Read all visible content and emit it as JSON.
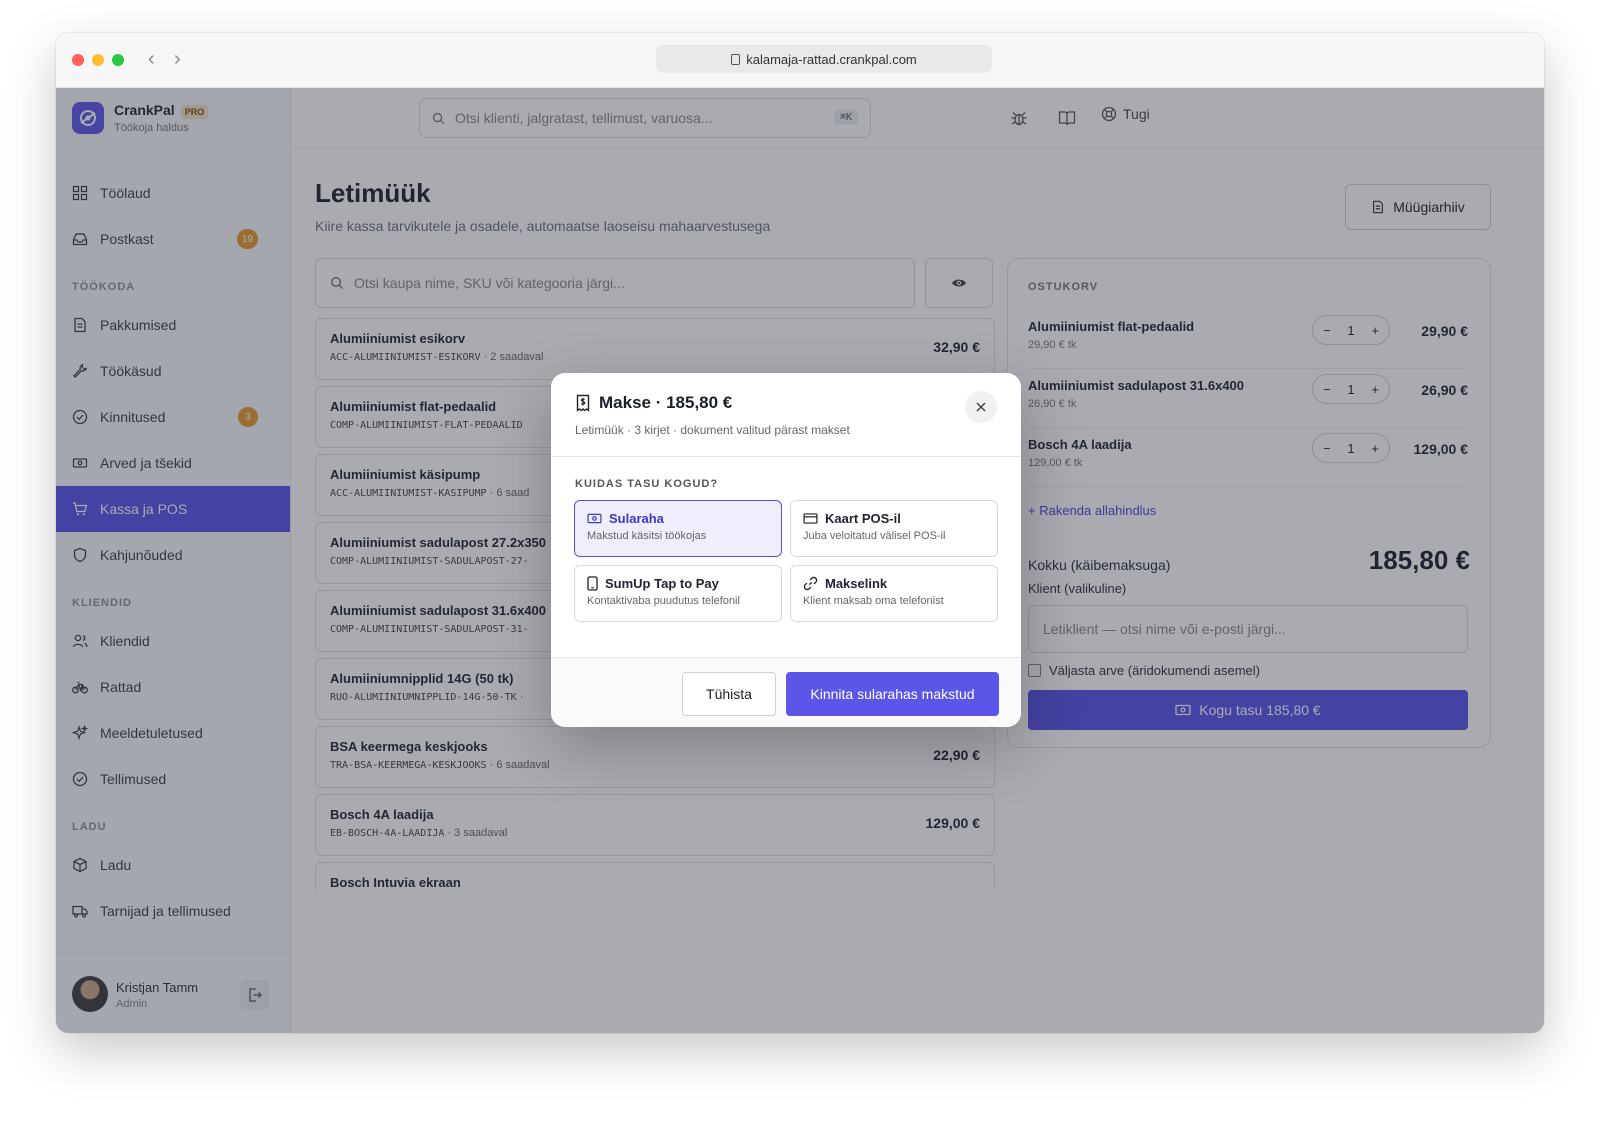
{
  "browser": {
    "url": "kalamaja-rattad.crankpal.com"
  },
  "brand": {
    "name": "CrankPal",
    "badge": "PRO",
    "subtitle": "Töökoja haldus"
  },
  "colors": {
    "accent": "#5850e6",
    "badge": "#e69a2e"
  },
  "search": {
    "placeholder": "Otsi klienti, jalgratast, tellimust, varuosa...",
    "shortcut": "⌘K"
  },
  "topbar": {
    "support": "Tugi"
  },
  "sidebar": {
    "items": [
      {
        "label": "Töölaud",
        "icon": "grid-icon"
      },
      {
        "label": "Postkast",
        "icon": "inbox-icon",
        "badge": "19"
      }
    ],
    "sections": [
      {
        "title": "TÖÖKODA",
        "items": [
          {
            "label": "Pakkumised",
            "icon": "document-icon"
          },
          {
            "label": "Töökäsud",
            "icon": "wrench-icon"
          },
          {
            "label": "Kinnitused",
            "icon": "check-circle-icon",
            "badge": "3"
          },
          {
            "label": "Arved ja tšekid",
            "icon": "cash-icon"
          },
          {
            "label": "Kassa ja POS",
            "icon": "cart-icon",
            "active": true
          },
          {
            "label": "Kahjunõuded",
            "icon": "shield-icon"
          }
        ]
      },
      {
        "title": "KLIENDID",
        "items": [
          {
            "label": "Kliendid",
            "icon": "users-icon"
          },
          {
            "label": "Rattad",
            "icon": "bike-icon"
          },
          {
            "label": "Meeldetuletused",
            "icon": "sparkle-icon"
          },
          {
            "label": "Tellimused",
            "icon": "check-circle-icon"
          }
        ]
      },
      {
        "title": "LADU",
        "items": [
          {
            "label": "Ladu",
            "icon": "box-icon"
          },
          {
            "label": "Tarnijad ja tellimused",
            "icon": "truck-icon"
          }
        ]
      }
    ]
  },
  "user": {
    "name": "Kristjan Tamm",
    "role": "Admin"
  },
  "page": {
    "title": "Letimüük",
    "subtitle": "Kiire kassa tarvikutele ja osadele, automaatse laoseisu mahaarvestusega",
    "archive_button": "Müügiarhiiv",
    "product_search_placeholder": "Otsi kaupa nime, SKU või kategooria järgi..."
  },
  "products": [
    {
      "name": "Alumiiniumist esikorv",
      "sku": "ACC-ALUMIINIUMIST-ESIKORV",
      "stock": " · 2 saadaval",
      "price": "32,90 €"
    },
    {
      "name": "Alumiiniumist flat-pedaalid",
      "sku": "COMP-ALUMIINIUMIST-FLAT-PEDAALID",
      "stock": "",
      "price": ""
    },
    {
      "name": "Alumiiniumist käsipump",
      "sku": "ACC-ALUMIINIUMIST-KASIPUMP",
      "stock": " · 6 saad",
      "price": ""
    },
    {
      "name": "Alumiiniumist sadulapost 27.2x350",
      "sku": "COMP-ALUMIINIUMIST-SADULAPOST-27-",
      "stock": "",
      "price": ""
    },
    {
      "name": "Alumiiniumist sadulapost 31.6x400",
      "sku": "COMP-ALUMIINIUMIST-SADULAPOST-31-",
      "stock": "",
      "price": ""
    },
    {
      "name": "Alumiiniumnipplid 14G (50 tk)",
      "sku": "RUO-ALUMIINIUMNIPPLID-14G-50-TK",
      "stock": " ·",
      "price": ""
    },
    {
      "name": "BSA keermega keskjooks",
      "sku": "TRA-BSA-KEERMEGA-KESKJOOKS",
      "stock": " · 6 saadaval",
      "price": "22,90 €"
    },
    {
      "name": "Bosch 4A laadija",
      "sku": "EB-BOSCH-4A-LAADIJA",
      "stock": " · 3 saadaval",
      "price": "129,00 €"
    },
    {
      "name": "Bosch Intuvia ekraan",
      "sku": "",
      "stock": "",
      "price": ""
    }
  ],
  "cart": {
    "title": "OSTUKORV",
    "items": [
      {
        "name": "Alumiiniumist flat-pedaalid",
        "unit": "29,90 € tk",
        "qty": "1",
        "total": "29,90 €"
      },
      {
        "name": "Alumiiniumist sadulapost 31.6x400",
        "unit": "26,90 € tk",
        "qty": "1",
        "total": "26,90 €"
      },
      {
        "name": "Bosch 4A laadija",
        "unit": "129,00 € tk",
        "qty": "1",
        "total": "129,00 €"
      }
    ],
    "discount_link": "+ Rakenda allahindlus",
    "total_label": "Kokku (käibemaksuga)",
    "total_value": "185,80 €",
    "client_label": "Klient (valikuline)",
    "client_placeholder": "Letiklient — otsi nime või e-posti järgi...",
    "invoice_checkbox": "Väljasta arve (äridokumendi asemel)",
    "collect_button": "Kogu tasu 185,80 €",
    "qty_minus": "−",
    "qty_plus": "+"
  },
  "modal": {
    "title": "Makse · 185,80 €",
    "subtitle": "Letimüük · 3 kirjet · dokument valitud pärast makset",
    "question": "KUIDAS TASU KOGUD?",
    "options": [
      {
        "title": "Sularaha",
        "desc": "Makstud käsitsi töökojas",
        "icon": "cash-icon",
        "selected": true
      },
      {
        "title": "Kaart POS-il",
        "desc": "Juba veloitatud välisel POS-il",
        "icon": "card-icon"
      },
      {
        "title": "SumUp Tap to Pay",
        "desc": "Kontaktivaba puudutus telefonil",
        "icon": "phone-icon"
      },
      {
        "title": "Makselink",
        "desc": "Klient maksab oma telefonist",
        "icon": "link-icon"
      }
    ],
    "cancel_button": "Tühista",
    "confirm_button": "Kinnita sularahas makstud"
  }
}
